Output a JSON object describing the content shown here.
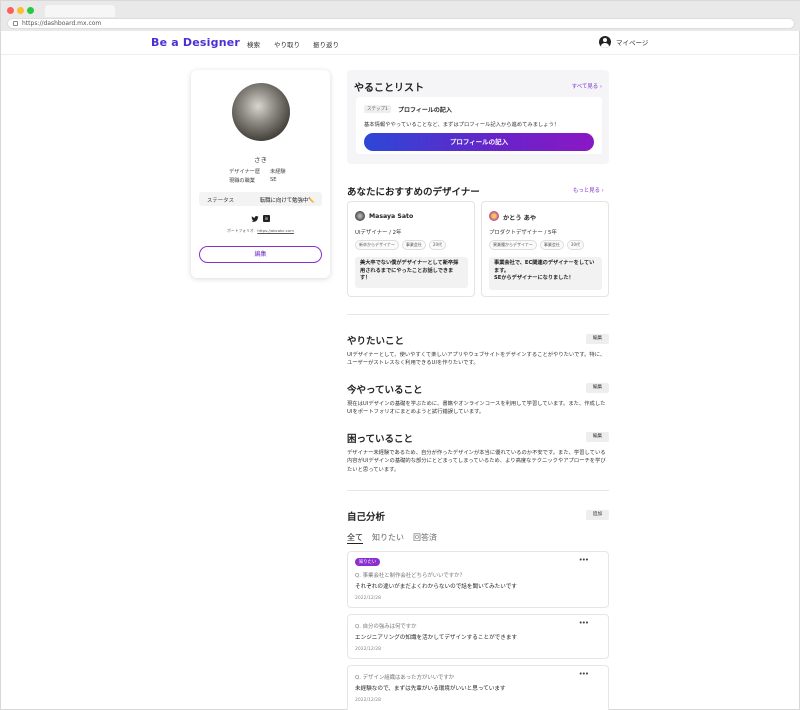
{
  "browser": {
    "url": "https://dashboard.mx.com"
  },
  "nav": {
    "logo": "Be a Designer",
    "links": [
      "検索",
      "やり取り",
      "振り返り"
    ],
    "mypage": "マイページ"
  },
  "profile": {
    "name": "さき",
    "designer_years_label": "デザイナー歴",
    "designer_years_value": "未経験",
    "job_label": "現職の職業",
    "job_value": "SE",
    "status_label": "ステータス",
    "status_value": "転職に向けて勉強中✏️",
    "portfolio_label": "ポートフォリオ",
    "portfolio_url": "https://abcabc.com",
    "edit_label": "編集"
  },
  "todo": {
    "title": "やることリスト",
    "see_all": "すべて見る ›",
    "step": "ステップ1",
    "step_title": "プロフィールの記入",
    "description": "基本情報ややっていることなど、まずはプロフィール記入から進めてみましょう！",
    "button": "プロフィールの記入"
  },
  "recommended": {
    "title": "あなたにおすすめのデザイナー",
    "more": "もっと見る ›",
    "designers": [
      {
        "name": "Masaya Sato",
        "role": "UIデザイナー / 2年",
        "tags": [
          "新卒からデザイナー",
          "事業会社",
          "20代"
        ],
        "message": "美大卒でない僕がデザイナーとして新卒採用されるまでにやったことお話しできます！"
      },
      {
        "name": "かとう あや",
        "role": "プロダクトデザイナー / 5年",
        "tags": [
          "異業種からデザイナー",
          "事業会社",
          "30代"
        ],
        "message": "事業会社で、EC関連のデザイナーをしています。\nSEからデザイナーになりました！"
      }
    ]
  },
  "sections": [
    {
      "title": "やりたいこと",
      "button": "編集",
      "text": "UIデザイナーとして、使いやすくて楽しいアプリやウェブサイトをデザインすることがやりたいです。特に、ユーザーがストレスなく利用できるUIを作りたいです。"
    },
    {
      "title": "今やっていること",
      "button": "編集",
      "text": "現在はUIデザインの基礎を学ぶために、書籍やオンラインコースを利用して学習しています。また、作成したUIをポートフォリオにまとめようと試行錯誤しています。"
    },
    {
      "title": "困っていること",
      "button": "編集",
      "text": "デザイナー未経験であるため、自分が作ったデザインが本当に優れているのか不安です。また、学習している内容がUIデザインの基礎的な部分にとどまってしまっているため、より高度なテクニックやアプローチを学びたいと思っています。"
    }
  ],
  "self_analysis": {
    "title": "自己分析",
    "add": "追加",
    "tabs": [
      "全て",
      "知りたい",
      "回答済"
    ],
    "items": [
      {
        "badge": "知りたい",
        "q": "Q. 事業会社と制作会社どちらがいいですか？",
        "a": "それぞれの違いがまだよくわからないので話を聞いてみたいです",
        "date": "2022/12/28"
      },
      {
        "badge": "",
        "q": "Q. 自分の強みは何ですか",
        "a": "エンジニアリングの知識を活かしてデザインすることができます",
        "date": "2022/12/28"
      },
      {
        "badge": "",
        "q": "Q. デザイン組織はあった方がいいですか",
        "a": "未経験なので、まずは先輩がいる環境がいいと思っています",
        "date": "2022/12/28"
      }
    ]
  },
  "colors": {
    "accent": "#7a2ed0",
    "gradient_start": "#2d47d6",
    "gradient_end": "#8a18c4"
  }
}
